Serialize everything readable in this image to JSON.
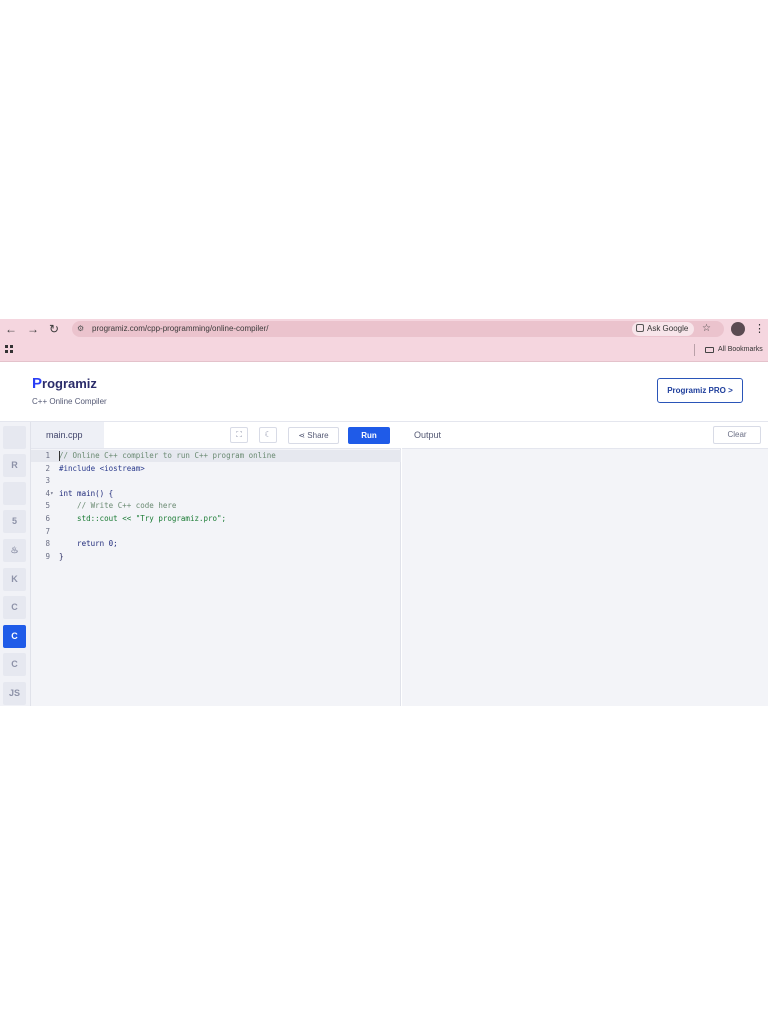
{
  "browser": {
    "url": "programiz.com/cpp-programming/online-compiler/",
    "ask_google": "Ask Google",
    "all_bookmarks": "All Bookmarks"
  },
  "header": {
    "logo": "Programiz",
    "logo_first": "P",
    "logo_rest": "rogramiz",
    "subtitle": "C++ Online Compiler",
    "pro_button": "Programiz PRO >"
  },
  "languages": [
    {
      "id": "python",
      "label": "",
      "icon": "python-icon",
      "active": false
    },
    {
      "id": "r",
      "label": "R",
      "icon": "r-icon",
      "active": false
    },
    {
      "id": "sql",
      "label": "",
      "icon": "database-icon",
      "active": false
    },
    {
      "id": "html",
      "label": "5",
      "icon": "html5-icon",
      "active": false
    },
    {
      "id": "java",
      "label": "♨",
      "icon": "java-icon",
      "active": false
    },
    {
      "id": "kotlin",
      "label": "K",
      "icon": "kotlin-icon",
      "active": false
    },
    {
      "id": "c",
      "label": "C",
      "icon": "c-icon",
      "active": false
    },
    {
      "id": "cpp",
      "label": "C",
      "icon": "cpp-icon",
      "active": true
    },
    {
      "id": "csharp",
      "label": "C",
      "icon": "csharp-icon",
      "active": false
    },
    {
      "id": "js",
      "label": "JS",
      "icon": "javascript-icon",
      "active": false
    }
  ],
  "editor": {
    "filename": "main.cpp",
    "share": "Share",
    "run": "Run",
    "lines": [
      {
        "n": "1",
        "text": "// Online C++ compiler to run C++ program online",
        "kind": "comment"
      },
      {
        "n": "2",
        "text": "#include <iostream>",
        "kind": "pp"
      },
      {
        "n": "3",
        "text": "",
        "kind": "plain"
      },
      {
        "n": "4",
        "text": "int main() {",
        "kind": "kw"
      },
      {
        "n": "5",
        "text": "    // Write C++ code here",
        "kind": "comment"
      },
      {
        "n": "6",
        "text": "    std::cout << \"Try programiz.pro\";",
        "kind": "str"
      },
      {
        "n": "7",
        "text": "",
        "kind": "plain"
      },
      {
        "n": "8",
        "text": "    return 0;",
        "kind": "kw"
      },
      {
        "n": "9",
        "text": "}",
        "kind": "plain"
      }
    ]
  },
  "output": {
    "title": "Output",
    "clear": "Clear"
  }
}
